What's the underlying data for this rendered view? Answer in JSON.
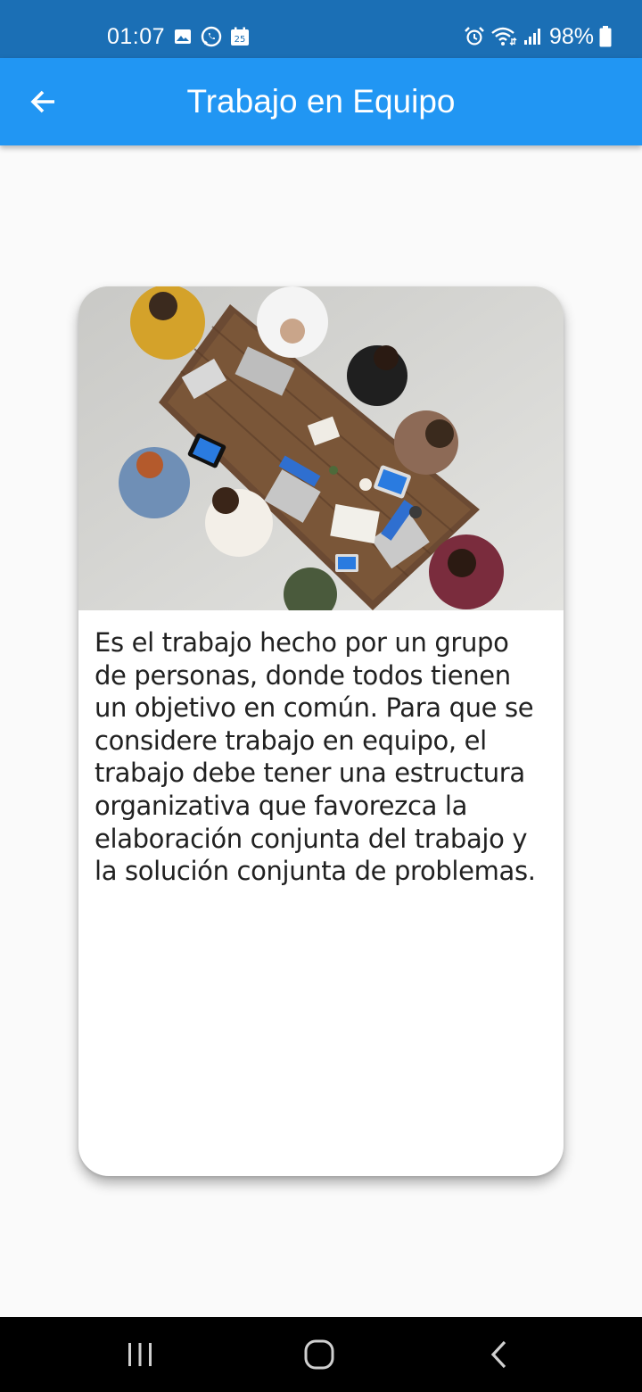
{
  "status_bar": {
    "time": "01:07",
    "left_icons": [
      "gallery-icon",
      "whatsapp-icon",
      "calendar-icon"
    ],
    "calendar_day": "25",
    "right_icons": [
      "alarm-icon",
      "wifi-icon",
      "signal-icon",
      "battery-icon"
    ],
    "battery_text": "98%",
    "background_color": "#1b6fb5"
  },
  "app_bar": {
    "title": "Trabajo en Equipo",
    "back_icon": "arrow-left-icon",
    "background_color": "#2196f3"
  },
  "card": {
    "image_icon": "team-meeting-photo",
    "text": "Es el trabajo hecho por un grupo de personas, donde todos tienen un objetivo en común. Para que se considere trabajo en equipo, el trabajo debe tener una estructura organizativa que favorezca la elaboración conjunta del trabajo y la solución conjunta de problemas."
  },
  "nav_bar": {
    "buttons": [
      "recent-apps-icon",
      "home-icon",
      "back-nav-icon"
    ]
  }
}
